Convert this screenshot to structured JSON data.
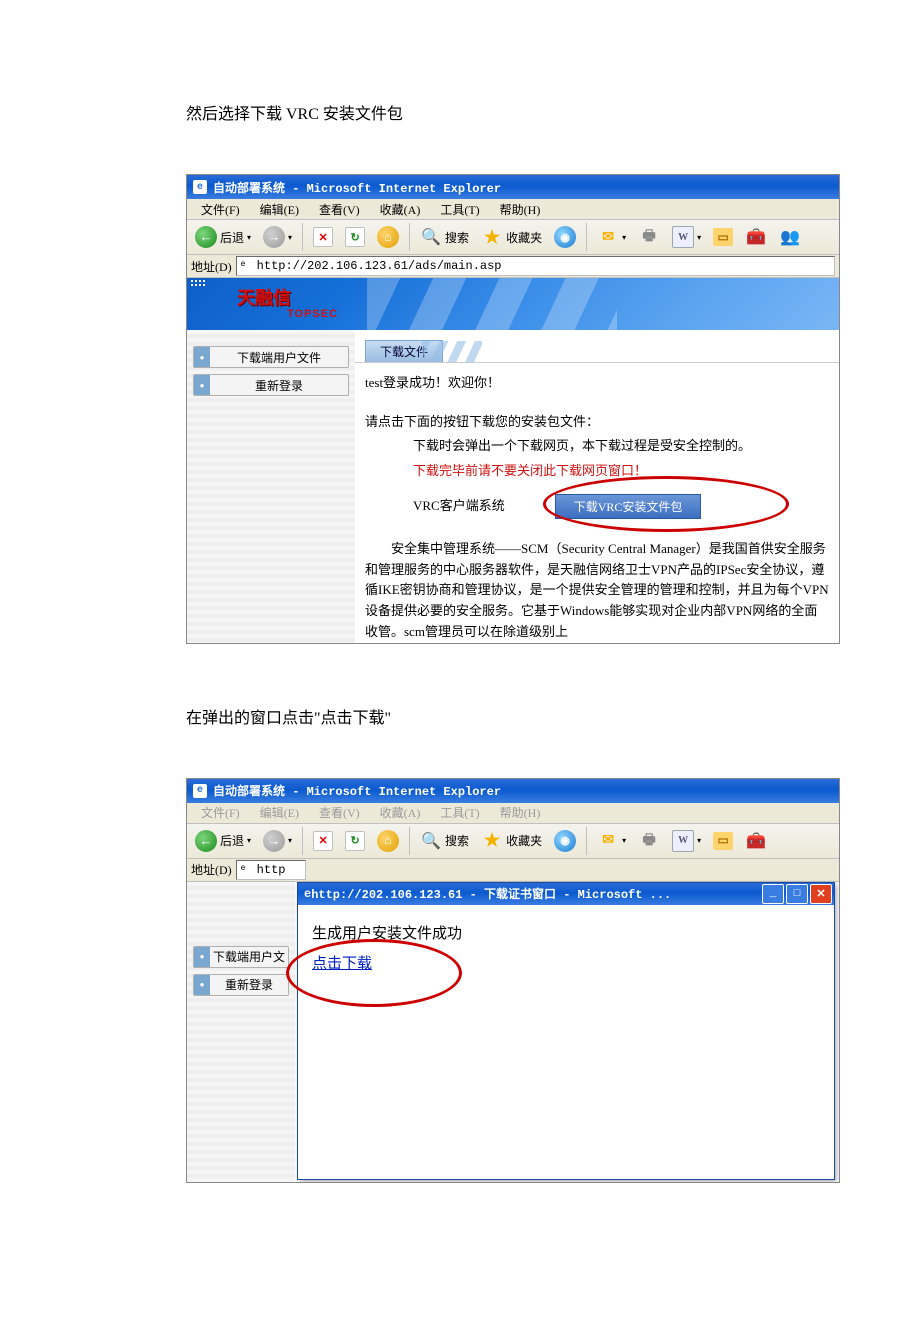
{
  "doc": {
    "instruction1": "然后选择下载 VRC 安装文件包",
    "instruction2": "在弹出的窗口点击\"点击下载\""
  },
  "ie": {
    "title": "自动部署系统 - Microsoft Internet Explorer",
    "menu": {
      "file": "文件(F)",
      "edit": "编辑(E)",
      "view": "查看(V)",
      "fav": "收藏(A)",
      "tool": "工具(T)",
      "help": "帮助(H)"
    },
    "toolbar": {
      "back": "后退",
      "search": "搜索",
      "favorites": "收藏夹"
    },
    "address_label": "地址(D)",
    "address_url": "http://202.106.123.61/ads/main.asp",
    "brand": "天融信",
    "brand_en": "TOPSEC",
    "sidebar": {
      "items": [
        "下载端用户文件",
        "重新登录"
      ]
    },
    "tab": "下载文件",
    "main": {
      "welcome": "test登录成功！欢迎你！",
      "prompt": "请点击下面的按钮下载您的安装包文件：",
      "note1": "下载时会弹出一个下载网页，本下载过程是受安全控制的。",
      "note2": "下载完毕前请不要关闭此下载网页窗口！",
      "vrc_label": "VRC客户端系统",
      "vrc_button": "下载VRC安装文件包",
      "desc": "安全集中管理系统——SCM（Security Central Manager）是我国首供安全服务和管理服务的中心服务器软件，是天融信网络卫士VPN产品的IPSec安全协议，遵循IKE密钥协商和管理协议，是一个提供安全管理的管理和控制，并且为每个VPN设备提供必要的安全服务。它基于Windows能够实现对企业内部VPN网络的全面收管。scm管理员可以在除道级别上"
    }
  },
  "popup": {
    "title": "http://202.106.123.61 - 下载证书窗口 - Microsoft ...",
    "line1": "生成用户安装文件成功",
    "link": "点击下载"
  },
  "ie2": {
    "address_partial": "http",
    "sidebar": {
      "items": [
        "下载端用户文",
        "重新登录"
      ]
    }
  }
}
